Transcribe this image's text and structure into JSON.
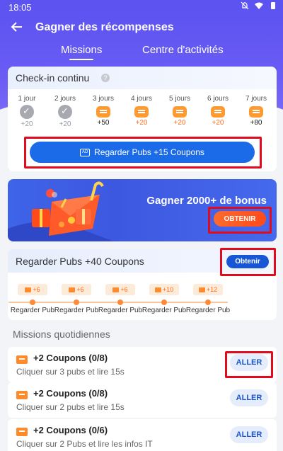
{
  "status_bar": {
    "time": "18:05"
  },
  "app_bar": {
    "title": "Gagner des récompenses"
  },
  "tabs": [
    {
      "label": "Missions",
      "active": true
    },
    {
      "label": "Centre d'activités",
      "active": false
    }
  ],
  "checkin": {
    "title": "Check-in continu",
    "days": [
      {
        "label": "1 jour",
        "amount": "+20",
        "state": "done"
      },
      {
        "label": "2 jours",
        "amount": "+20",
        "state": "done"
      },
      {
        "label": "3 jours",
        "amount": "+50",
        "state": "current"
      },
      {
        "label": "4 jours",
        "amount": "+20",
        "state": "upcoming"
      },
      {
        "label": "5 jours",
        "amount": "+20",
        "state": "upcoming"
      },
      {
        "label": "6 jours",
        "amount": "+20",
        "state": "upcoming"
      },
      {
        "label": "7 jours",
        "amount": "+80",
        "state": "current"
      }
    ],
    "button_label": "Regarder Pubs +15 Coupons",
    "ad_icon_text": "AD"
  },
  "banner": {
    "headline": "Gagner 2000+ de bonus",
    "button_label": "OBTENIR"
  },
  "pubs40": {
    "title": "Regarder Pubs +40 Coupons",
    "button_label": "Obtenir",
    "steps": [
      {
        "reward": "+6",
        "label": "Regarder Pub"
      },
      {
        "reward": "+6",
        "label": "Regarder Pub"
      },
      {
        "reward": "+6",
        "label": "Regarder Pub"
      },
      {
        "reward": "+10",
        "label": "Regarder Pub"
      },
      {
        "reward": "+12",
        "label": "Regarder Pub"
      }
    ]
  },
  "daily": {
    "section_title": "Missions quotidiennes",
    "items": [
      {
        "title": "+2 Coupons (0/8)",
        "subtitle": "Cliquer sur 3 pubs et lire 15s",
        "button": "ALLER"
      },
      {
        "title": "+2 Coupons (0/8)",
        "subtitle": "Cliquer sur 2 pubs et lire 15s",
        "button": "ALLER"
      },
      {
        "title": "+2 Coupons (0/6)",
        "subtitle": "Cliquer sur 2 Pubs et lire les infos IT",
        "button": "ALLER"
      }
    ]
  },
  "colors": {
    "header": "#5b52f0",
    "primary_blue": "#1b6be8",
    "accent_orange": "#ff6f1f",
    "highlight_frame": "#e00b1c"
  }
}
